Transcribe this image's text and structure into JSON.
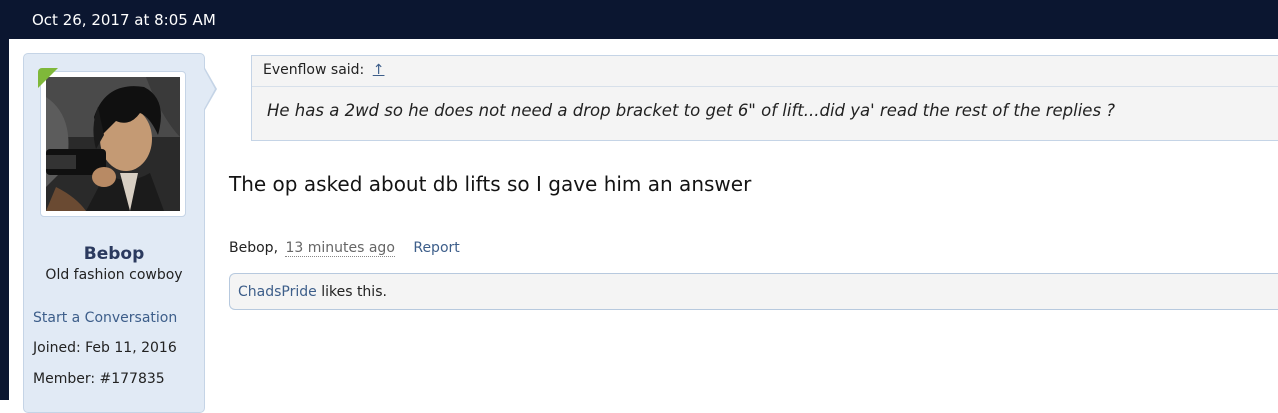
{
  "post": {
    "date": "Oct 26, 2017 at 8:05 AM",
    "message": "The op asked about db lifts so I gave him an answer",
    "author": "Bebop",
    "author_suffix": ",",
    "time_ago": "13 minutes ago",
    "report_label": "Report"
  },
  "user": {
    "name": "Bebop",
    "title": "Old fashion cowboy",
    "start_conversation": "Start a Conversation",
    "joined_label": "Joined:",
    "joined_value": "Feb 11, 2016",
    "member_label": "Member:",
    "member_value": "#177835",
    "avatar_icon": "avatar-image"
  },
  "quote": {
    "author": "Evenflow said:",
    "jump_icon": "↑",
    "text": "He has a 2wd so he does not need a drop bracket to get 6\" of lift...did ya' read the rest of the replies ?"
  },
  "likes": {
    "liker": "ChadsPride",
    "suffix": " likes this."
  },
  "colors": {
    "header_bg": "#0b1630",
    "panel_bg": "#e1eaf5",
    "link": "#3d5e8a",
    "online": "#7fb83a"
  }
}
